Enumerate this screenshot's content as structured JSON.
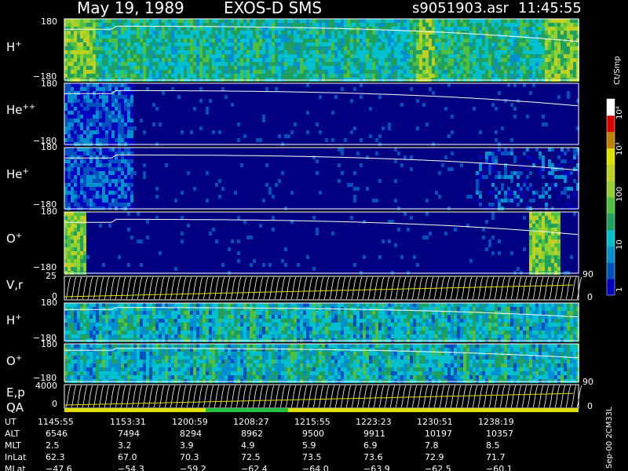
{
  "header": {
    "date_title": "May 19, 1989",
    "instrument": "EXOS-D SMS",
    "file_name": "s9051903.asr",
    "time": "11:45:55"
  },
  "chart_data": {
    "type": "heatmap",
    "panels": [
      {
        "id": "h_plus",
        "label": "H",
        "sup": "+",
        "ymin": "−180",
        "ymax": "180",
        "ylim": [
          -180,
          180
        ],
        "overall_level": "high",
        "hot_bands": [
          [
            0.0,
            0.06
          ],
          [
            0.68,
            0.72
          ],
          [
            0.93,
            1.0
          ]
        ]
      },
      {
        "id": "he_pp",
        "label": "He",
        "sup": "++",
        "ymin": "−180",
        "ymax": "180",
        "ylim": [
          -180,
          180
        ],
        "overall_level": "low",
        "active_region": [
          0.0,
          0.13
        ]
      },
      {
        "id": "he_plus",
        "label": "He",
        "sup": "+",
        "ymin": "−180",
        "ymax": "180",
        "ylim": [
          -180,
          180
        ],
        "overall_level": "low",
        "active_region": [
          0.0,
          0.13
        ],
        "late_activity": [
          0.8,
          1.0
        ]
      },
      {
        "id": "o_plus",
        "label": "O",
        "sup": "+",
        "ymin": "−180",
        "ymax": "180",
        "ylim": [
          -180,
          180
        ],
        "overall_level": "low",
        "hot_bands": [
          [
            0.0,
            0.04
          ],
          [
            0.9,
            0.96
          ]
        ]
      },
      {
        "id": "vr",
        "label": "V,r",
        "left_tick": "25",
        "left_tick_low": "0",
        "right_ticks": [
          "90",
          "0"
        ]
      },
      {
        "id": "h_plus_2",
        "label": "H",
        "sup": "+",
        "ymin": "−180",
        "ymax": "180",
        "ylim": [
          -180,
          180
        ],
        "overall_level": "medium"
      },
      {
        "id": "o_plus_2",
        "label": "O",
        "sup": "+",
        "ymin": "−180",
        "ymax": "180",
        "ylim": [
          -180,
          180
        ],
        "overall_level": "medium"
      },
      {
        "id": "ep",
        "label": "E,p",
        "left_tick": "4000",
        "left_tick_low": "0",
        "right_ticks": [
          "90",
          "0"
        ]
      }
    ],
    "qa_label": "QA",
    "colorbar": {
      "unit_label": "Ct/Smp",
      "tick_labels": [
        "1",
        "10",
        "100",
        "10³",
        "10⁴"
      ],
      "scale": "log",
      "range": [
        1,
        10000
      ]
    },
    "footer_rows": [
      {
        "label": "UT",
        "values": [
          "1145:55",
          "1153:31",
          "1200:59",
          "1208:27",
          "1215:55",
          "1223:23",
          "1230:51",
          "1238:19"
        ]
      },
      {
        "label": "ALT",
        "values": [
          "6546",
          "7494",
          "8294",
          "8962",
          "9500",
          "9911",
          "10197",
          "10357"
        ]
      },
      {
        "label": "MLT",
        "values": [
          "2.5",
          "3.2",
          "3.9",
          "4.9",
          "5.9",
          "6.9",
          "7.8",
          "8.5"
        ]
      },
      {
        "label": "InLat",
        "values": [
          "62.3",
          "67.0",
          "70.3",
          "72.5",
          "73.5",
          "73.6",
          "72.9",
          "71.7"
        ]
      },
      {
        "label": "MLat",
        "values": [
          "−47.6",
          "−54.3",
          "−59.2",
          "−62.4",
          "−64.0",
          "−63.9",
          "−62.5",
          "−60.1"
        ]
      }
    ],
    "side_note": "Sep-00 2CM33L"
  }
}
